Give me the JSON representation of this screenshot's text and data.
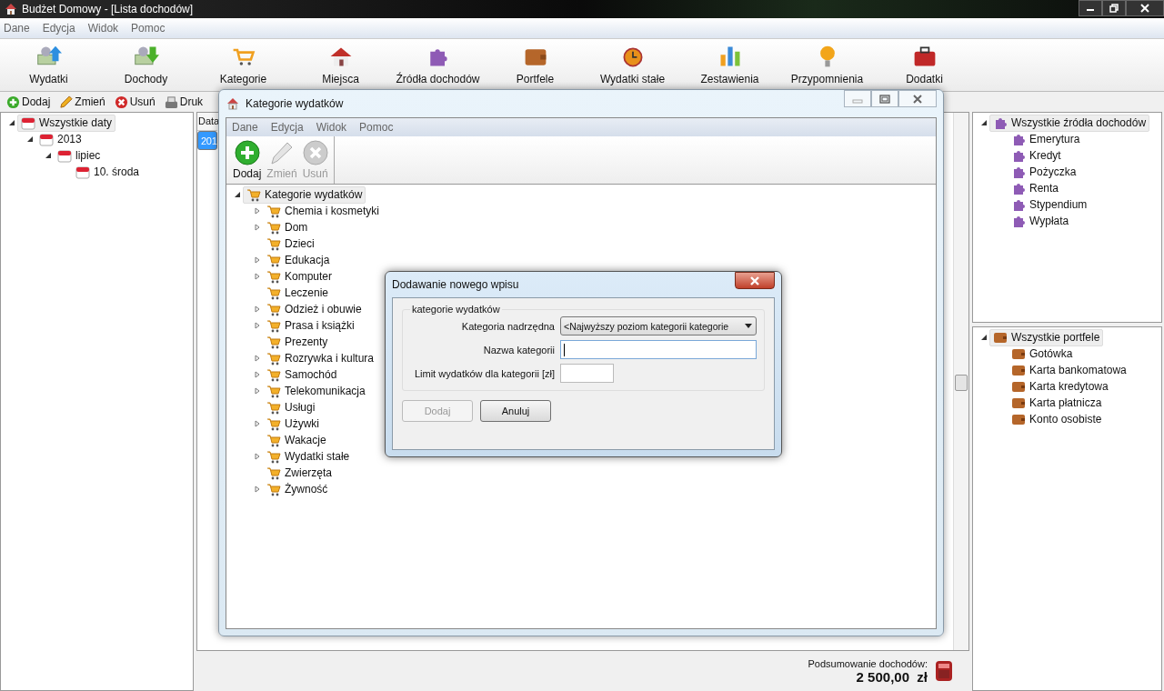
{
  "window": {
    "title": "Budżet Domowy - [Lista dochodów]"
  },
  "menu": [
    "Dane",
    "Edycja",
    "Widok",
    "Pomoc"
  ],
  "toolbar": [
    {
      "label": "Wydatki",
      "kind": "expenses"
    },
    {
      "label": "Dochody",
      "kind": "income"
    },
    {
      "label": "Kategorie",
      "kind": "categories"
    },
    {
      "label": "Miejsca",
      "kind": "places"
    },
    {
      "label": "Źródła dochodów",
      "kind": "sources"
    },
    {
      "label": "Portfele",
      "kind": "wallets"
    },
    {
      "label": "Wydatki stałe",
      "kind": "fixed"
    },
    {
      "label": "Zestawienia",
      "kind": "reports"
    },
    {
      "label": "Przypomnienia",
      "kind": "reminders"
    },
    {
      "label": "Dodatki",
      "kind": "addons"
    }
  ],
  "actions": [
    {
      "label": "Dodaj",
      "kind": "add"
    },
    {
      "label": "Zmień",
      "kind": "edit"
    },
    {
      "label": "Usuń",
      "kind": "delete"
    },
    {
      "label": "Druk",
      "kind": "print"
    }
  ],
  "date_tree": {
    "label": "Wszystkie daty",
    "selected": true,
    "expanded": true,
    "children": [
      {
        "label": "2013",
        "selected": false,
        "expanded": true,
        "children": [
          {
            "label": "lipiec",
            "selected": false,
            "expanded": true,
            "children": [
              {
                "label": "10. środa",
                "selected": false
              }
            ]
          }
        ]
      }
    ]
  },
  "income_list": {
    "columns": [
      "Data"
    ],
    "rows": [
      {
        "cells": [
          "201"
        ],
        "selected": true
      }
    ]
  },
  "summary": {
    "label": "Podsumowanie dochodów:",
    "value": "2 500,00  zł"
  },
  "sources_tree": {
    "label": "Wszystkie źródła dochodów",
    "selected": true,
    "expanded": true,
    "children": [
      {
        "label": "Emerytura",
        "selected": false
      },
      {
        "label": "Kredyt",
        "selected": false
      },
      {
        "label": "Pożyczka",
        "selected": false
      },
      {
        "label": "Renta",
        "selected": false
      },
      {
        "label": "Stypendium",
        "selected": false
      },
      {
        "label": "Wypłata",
        "selected": false
      }
    ]
  },
  "wallets_tree": {
    "label": "Wszystkie portfele",
    "selected": true,
    "expanded": true,
    "children": [
      {
        "label": "Gotówka",
        "selected": false
      },
      {
        "label": "Karta bankomatowa",
        "selected": false
      },
      {
        "label": "Karta kredytowa",
        "selected": false
      },
      {
        "label": "Karta płatnicza",
        "selected": false
      },
      {
        "label": "Konto osobiste",
        "selected": false
      }
    ]
  },
  "category_window": {
    "title": "Kategorie wydatków",
    "menu": [
      "Dane",
      "Edycja",
      "Widok",
      "Pomoc"
    ],
    "actions": [
      {
        "label": "Dodaj",
        "kind": "add",
        "disabled": false
      },
      {
        "label": "Zmień",
        "kind": "edit",
        "disabled": true
      },
      {
        "label": "Usuń",
        "kind": "delete",
        "disabled": true
      }
    ],
    "tree": {
      "label": "Kategorie wydatków",
      "selected": true,
      "expanded": true,
      "children": [
        {
          "label": "Chemia i kosmetyki",
          "selected": false,
          "has_children": true
        },
        {
          "label": "Dom",
          "selected": false,
          "has_children": true
        },
        {
          "label": "Dzieci",
          "selected": false,
          "has_children": false
        },
        {
          "label": "Edukacja",
          "selected": false,
          "has_children": true
        },
        {
          "label": "Komputer",
          "selected": false,
          "has_children": true
        },
        {
          "label": "Leczenie",
          "selected": false,
          "has_children": false
        },
        {
          "label": "Odzież i obuwie",
          "selected": false,
          "has_children": true
        },
        {
          "label": "Prasa i książki",
          "selected": false,
          "has_children": true
        },
        {
          "label": "Prezenty",
          "selected": false,
          "has_children": false
        },
        {
          "label": "Rozrywka i kultura",
          "selected": false,
          "has_children": true
        },
        {
          "label": "Samochód",
          "selected": false,
          "has_children": true
        },
        {
          "label": "Telekomunikacja",
          "selected": false,
          "has_children": true
        },
        {
          "label": "Usługi",
          "selected": false,
          "has_children": false
        },
        {
          "label": "Używki",
          "selected": false,
          "has_children": true
        },
        {
          "label": "Wakacje",
          "selected": false,
          "has_children": false
        },
        {
          "label": "Wydatki stałe",
          "selected": false,
          "has_children": true
        },
        {
          "label": "Zwierzęta",
          "selected": false,
          "has_children": false
        },
        {
          "label": "Żywność",
          "selected": false,
          "has_children": true
        }
      ]
    }
  },
  "dialog": {
    "title": "Dodawanie nowego wpisu",
    "group": "kategorie wydatków",
    "fields": [
      {
        "kind": "select",
        "label": "Kategoria nadrzędna",
        "value": "<Najwyższy poziom kategorii kategorie"
      },
      {
        "kind": "text",
        "label": "Nazwa kategorii",
        "focused": true
      },
      {
        "kind": "amount",
        "label": "Limit wydatków dla kategorii [zł]",
        "focused": false
      }
    ],
    "buttons": [
      {
        "label": "Dodaj",
        "disabled": true
      },
      {
        "label": "Anuluj",
        "disabled": false
      }
    ]
  }
}
